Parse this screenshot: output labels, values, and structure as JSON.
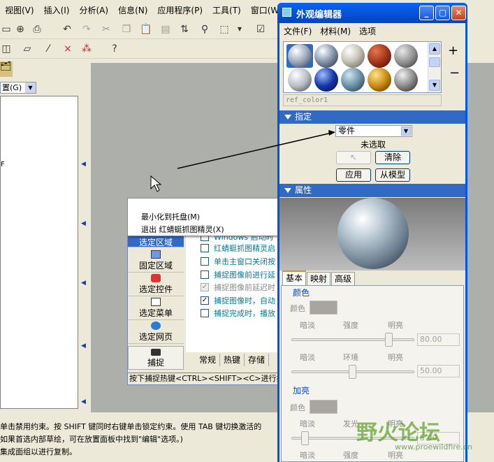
{
  "main_menu": [
    "视图(V)",
    "插入(I)",
    "分析(A)",
    "信息(N)",
    "应用程序(P)",
    "工具(T)",
    "窗口(W)"
  ],
  "left_combo": "置(G)",
  "tree_text": "F",
  "messages": [
    "单击禁用约束。按 SHIFT 键同时右键单击锁定约束。使用 TAB 键切换激活的",
    "如果首选内部草绘，可在放置面板中找到\"编辑\"选项。)",
    "",
    "集成面组以进行复制。"
  ],
  "tray_app": {
    "context_menu": [
      "最小化到托盘(M)",
      "退出 红蜻蜓抓图精灵(X)"
    ],
    "nav": [
      "选定区域",
      "固定区域",
      "选定控件",
      "选定菜单",
      "选定网页"
    ],
    "capture": "捕捉",
    "options": [
      {
        "text": "Windows 启动时",
        "checked": false,
        "disabled": false
      },
      {
        "text": "红蜻蜓抓图精灵启",
        "checked": false,
        "disabled": false
      },
      {
        "text": "单击主窗口关闭按",
        "checked": false,
        "disabled": false
      },
      {
        "text": "捕捉图像前进行延",
        "checked": false,
        "disabled": false
      },
      {
        "text": "捕捉图像前延迟时",
        "checked": true,
        "disabled": true
      },
      {
        "text": "捕捉图像时，自动",
        "checked": true,
        "disabled": false
      },
      {
        "text": "捕捉完成时，播放",
        "checked": false,
        "disabled": false
      }
    ],
    "tabs": [
      "常规",
      "热键",
      "存储"
    ],
    "status": "按下捕捉热键<CTRL><SHIFT><C>进行捕捉"
  },
  "editor": {
    "title": "外观编辑器",
    "menu": [
      "文件(F)",
      "材料(M)",
      "选项"
    ],
    "ref_name": "ref_color1",
    "assign_label": "指定",
    "assign_select": "零件",
    "not_selected": "未选取",
    "clear": "清除",
    "apply": "应用",
    "from_model": "从模型",
    "properties_label": "属性",
    "tabs": [
      "基本",
      "映射",
      "高级"
    ],
    "color_group": "颜色",
    "color_label": "颜色",
    "dark": "暗淡",
    "intensity": "强度",
    "bright": "明亮",
    "intensity_val": "80.00",
    "ambient": "环境",
    "ambient_val": "50.00",
    "highlight_group": "加亮",
    "highlight_color": "颜色",
    "shine": "发光",
    "shine_val": "5.00",
    "intensity2": "强度"
  },
  "watermark": "野火论坛",
  "watermark_url": "www.proewildfire.cn",
  "colors": {
    "selection_blue": "#316ac5",
    "xp_title_blue": "#0054e3"
  }
}
